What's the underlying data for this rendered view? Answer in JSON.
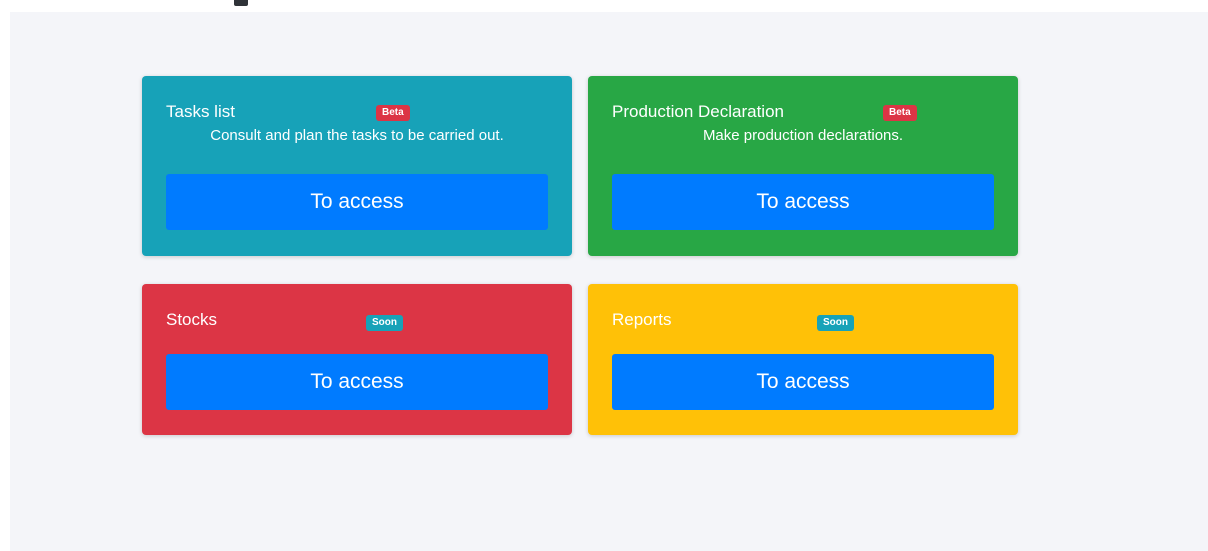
{
  "cards": [
    {
      "title": "Tasks list",
      "badge": "Beta",
      "description": "Consult and plan the tasks to be carried out.",
      "button_label": "To access",
      "color": "#17a2b8"
    },
    {
      "title": "Production Declaration",
      "badge": "Beta",
      "description": "Make production declarations.",
      "button_label": "To access",
      "color": "#28a745"
    },
    {
      "title": "Stocks",
      "badge": "Soon",
      "button_label": "To access",
      "color": "#dc3545"
    },
    {
      "title": "Reports",
      "badge": "Soon",
      "button_label": "To access",
      "color": "#ffc107"
    }
  ],
  "colors": {
    "panel_background": "#f4f5f9",
    "button": "#007bff",
    "badge_beta": "#dc3545",
    "badge_soon": "#17a2b8"
  }
}
